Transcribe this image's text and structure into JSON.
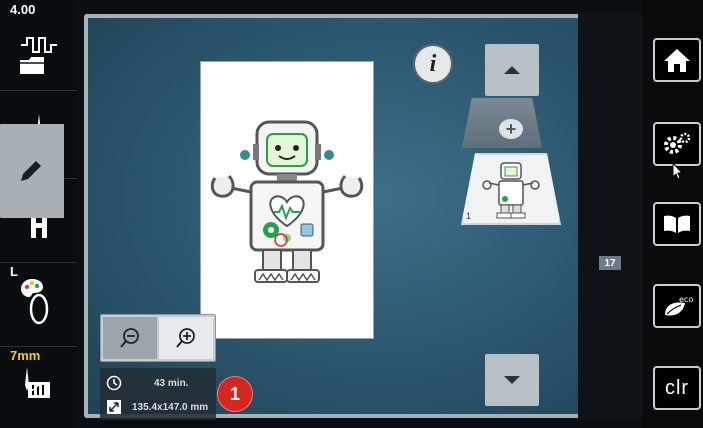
{
  "status": {
    "tension": "4.00",
    "foot": "JL",
    "hoop": "L",
    "stitch_length": "7mm"
  },
  "main": {
    "info_label": "i",
    "layer_number": "1"
  },
  "info": {
    "time": "43 min.",
    "size": "135.4x147.0 mm"
  },
  "callout": "1",
  "tabs": {
    "colors_badge": "17"
  },
  "right": {
    "clr_label": "clr"
  },
  "colors": {
    "panel": "#2e5a73",
    "frame": "#a9b1b8",
    "badge_red": "#d42722",
    "yellow_label": "#f1d20e",
    "robot_green": "#2aa04a",
    "robot_teal": "#3a8a8a"
  },
  "icons": {
    "tension": "tension-icon",
    "needle": "needle-icon",
    "foot": "presser-foot-icon",
    "hoop": "hoop-icon",
    "feed": "feed-dog-icon",
    "info": "info-icon",
    "folder": "folder-icon",
    "edit": "pencil-icon",
    "colors": "palette-icon",
    "stitch_out": "stitch-out-icon",
    "home": "home-icon",
    "settings": "gears-icon",
    "tutorial": "book-icon",
    "eco": "eco-icon"
  }
}
